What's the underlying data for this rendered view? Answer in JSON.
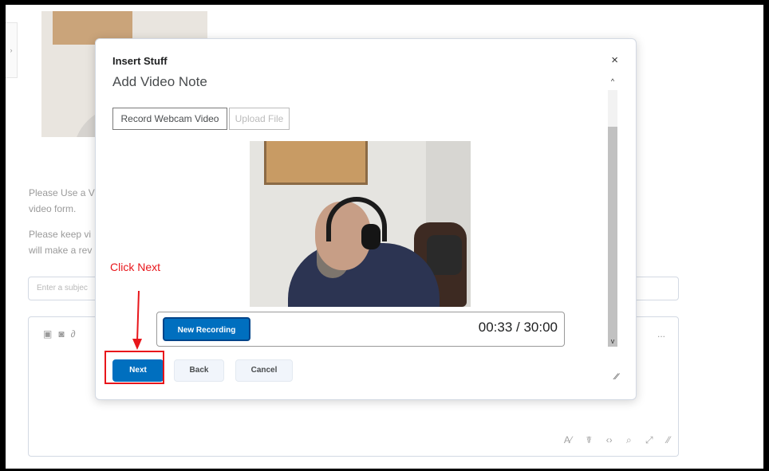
{
  "background": {
    "instructions": [
      "Please Use a V",
      "video form.",
      "Please keep vi",
      "will make a rev"
    ],
    "subject_placeholder": "Enter a subjec",
    "editor_more": "...",
    "tab_glyph": "›"
  },
  "dialog": {
    "title": "Insert Stuff",
    "heading": "Add Video Note",
    "close_glyph": "×",
    "tabs": {
      "record": "Record Webcam Video",
      "upload": "Upload File"
    },
    "new_recording_label": "New Recording",
    "timer": "00:33 / 30:00",
    "buttons": {
      "next": "Next",
      "back": "Back",
      "cancel": "Cancel"
    },
    "scroll_up_glyph": "^",
    "scroll_down_glyph": "v"
  },
  "annotation": {
    "text": "Click Next",
    "color": "#e8161b"
  },
  "colors": {
    "primary": "#006fbf",
    "primary_border": "#004489",
    "secondary_bg": "#f1f5fb"
  },
  "icons": [
    "close-icon",
    "scroll-up-icon",
    "scroll-down-icon",
    "resize-handle-icon",
    "arrow-annotation-icon",
    "video-icon",
    "camera-icon",
    "link-icon",
    "more-icon"
  ]
}
